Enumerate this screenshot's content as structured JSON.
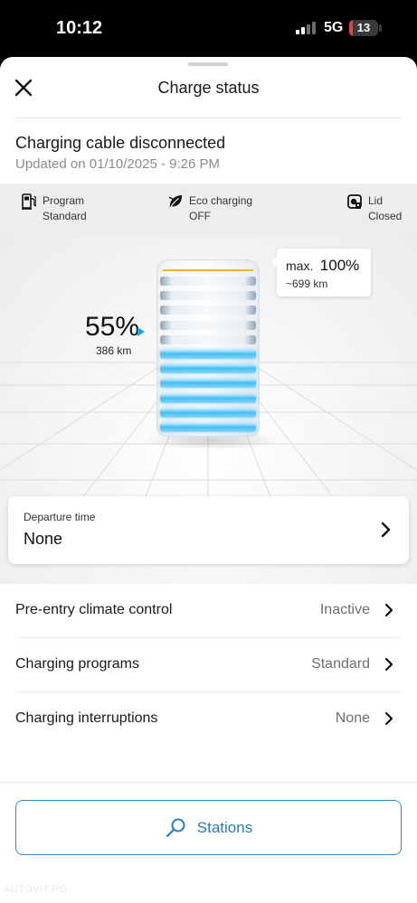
{
  "status_bar": {
    "time": "10:12",
    "network": "5G",
    "battery_level": "13",
    "battery_fill_fraction": 0.13
  },
  "header": {
    "title": "Charge status"
  },
  "charging_status": {
    "heading": "Charging cable disconnected",
    "updated": "Updated on 01/10/2025 - 9:26 PM"
  },
  "info_strip": {
    "program": {
      "label": "Program",
      "value": "Standard",
      "icon": "charging-station-icon"
    },
    "eco": {
      "label": "Eco charging",
      "value": "OFF",
      "icon": "leaf-icon"
    },
    "lid": {
      "label": "Lid",
      "value": "Closed",
      "icon": "charge-lid-icon"
    }
  },
  "battery": {
    "current_soc_label": "55%",
    "current_soc_fraction": 0.55,
    "current_range": "386 km",
    "max_label": "max.",
    "max_value": "100%",
    "max_range": "~699 km",
    "total_cells": 11,
    "filled_cells": 6,
    "colors": {
      "filled": "#47bdf0",
      "max_line": "#f2b430",
      "marker": "#1aa5e0"
    }
  },
  "departure": {
    "label": "Departure time",
    "value": "None"
  },
  "settings": [
    {
      "label": "Pre-entry climate control",
      "value": "Inactive"
    },
    {
      "label": "Charging programs",
      "value": "Standard"
    },
    {
      "label": "Charging interruptions",
      "value": "None"
    }
  ],
  "stations_button": {
    "label": "Stations",
    "icon": "search-icon"
  },
  "watermark": "AUTOVIT.RO",
  "accent_color": "#1f7fc0"
}
